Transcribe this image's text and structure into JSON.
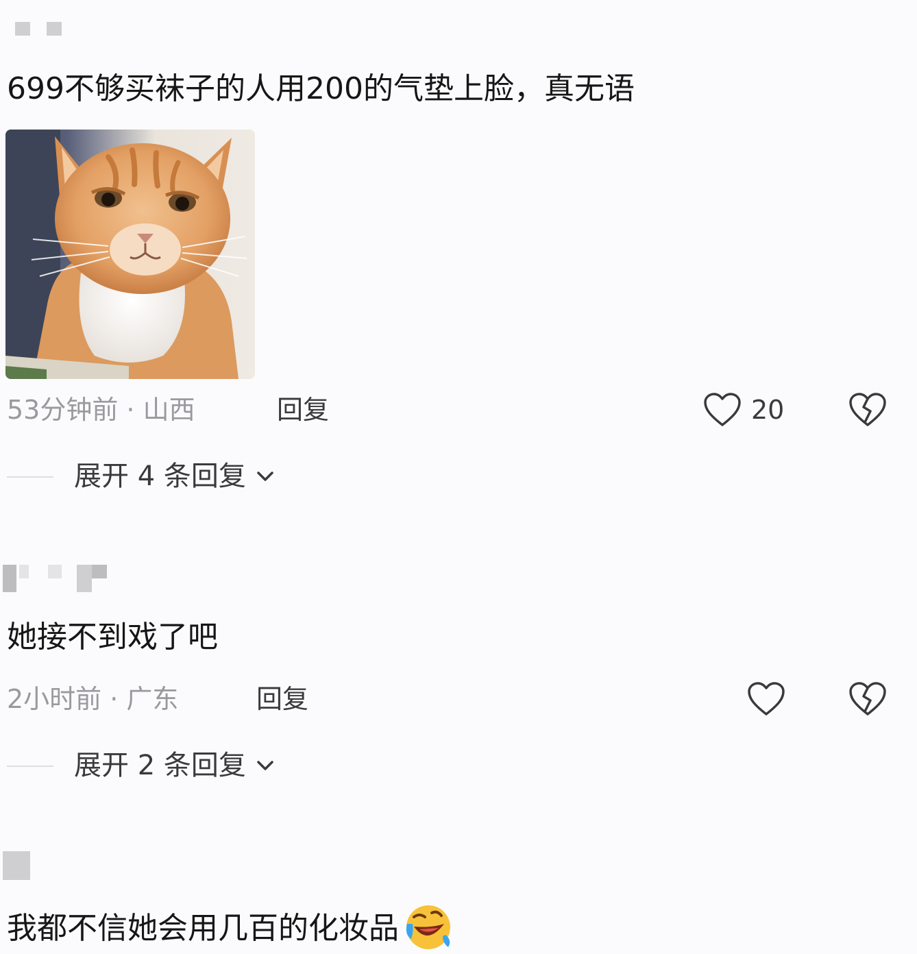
{
  "comments": [
    {
      "text": "699不够买袜子的人用200的气垫上脸，真无语",
      "time_location": "53分钟前 · 山西",
      "reply_label": "回复",
      "like_count": "20",
      "expand_label": "展开 4 条回复",
      "image": "orange-tabby-cat-meme"
    },
    {
      "text": "她接不到戏了吧",
      "time_location": "2小时前 · 广东",
      "reply_label": "回复",
      "like_count": "",
      "expand_label": "展开 2 条回复"
    },
    {
      "text": "我都不信她会用几百的化妆品",
      "emoji": "rolling-laughing-emoji"
    }
  ],
  "icons": {
    "like": "heart-outline-icon",
    "dislike": "broken-heart-icon",
    "expand": "chevron-down-icon"
  },
  "colors": {
    "background": "#fbfbfd",
    "text_primary": "#161616",
    "text_meta": "#9a9a9e",
    "text_action": "#3a3a3c",
    "username_blur": "#cfcfd2"
  }
}
